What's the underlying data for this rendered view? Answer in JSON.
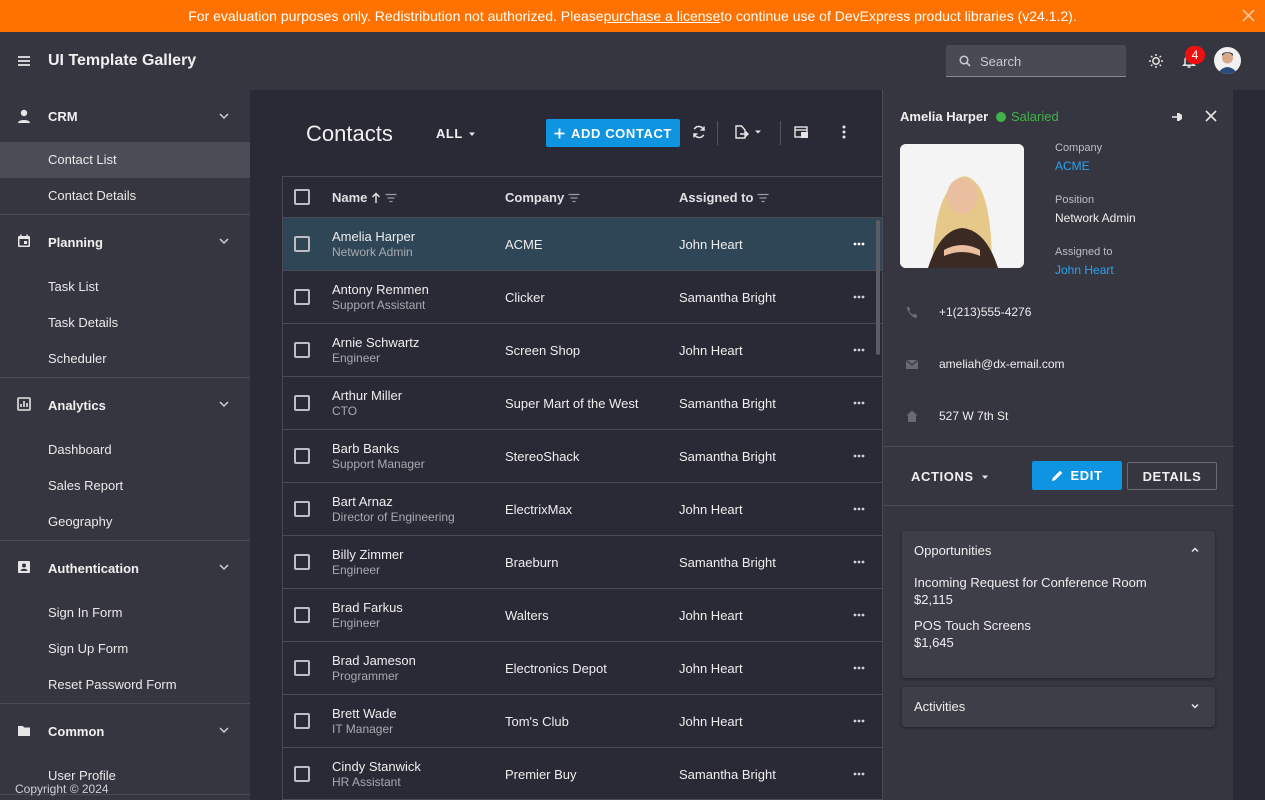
{
  "banner": {
    "text_before": "For evaluation purposes only. Redistribution not authorized. Please ",
    "link": "purchase a license",
    "text_after": " to continue use of DevExpress product libraries (v24.1.2)."
  },
  "header": {
    "title": "UI Template Gallery",
    "search_placeholder": "Search",
    "notification_count": "4"
  },
  "sidebar": {
    "groups": [
      {
        "label": "CRM",
        "icon": "person-icon",
        "items": [
          "Contact List",
          "Contact Details"
        ]
      },
      {
        "label": "Planning",
        "icon": "calendar-icon",
        "items": [
          "Task List",
          "Task Details",
          "Scheduler"
        ]
      },
      {
        "label": "Analytics",
        "icon": "chart-icon",
        "items": [
          "Dashboard",
          "Sales Report",
          "Geography"
        ]
      },
      {
        "label": "Authentication",
        "icon": "id-card-icon",
        "items": [
          "Sign In Form",
          "Sign Up Form",
          "Reset Password Form"
        ]
      },
      {
        "label": "Common",
        "icon": "folder-icon",
        "items": [
          "User Profile"
        ]
      }
    ],
    "active_item": "Contact List",
    "copyright": "Copyright © 2024"
  },
  "main": {
    "title": "Contacts",
    "filter": "ALL",
    "add_button": "ADD CONTACT",
    "columns": {
      "name": "Name",
      "company": "Company",
      "assigned": "Assigned to"
    },
    "rows": [
      {
        "name": "Amelia Harper",
        "position": "Network Admin",
        "company": "ACME",
        "assigned": "John Heart"
      },
      {
        "name": "Antony Remmen",
        "position": "Support Assistant",
        "company": "Clicker",
        "assigned": "Samantha Bright"
      },
      {
        "name": "Arnie Schwartz",
        "position": "Engineer",
        "company": "Screen Shop",
        "assigned": "John Heart"
      },
      {
        "name": "Arthur Miller",
        "position": "CTO",
        "company": "Super Mart of the West",
        "assigned": "Samantha Bright"
      },
      {
        "name": "Barb Banks",
        "position": "Support Manager",
        "company": "StereoShack",
        "assigned": "Samantha Bright"
      },
      {
        "name": "Bart Arnaz",
        "position": "Director of Engineering",
        "company": "ElectrixMax",
        "assigned": "John Heart"
      },
      {
        "name": "Billy Zimmer",
        "position": "Engineer",
        "company": "Braeburn",
        "assigned": "Samantha Bright"
      },
      {
        "name": "Brad Farkus",
        "position": "Engineer",
        "company": "Walters",
        "assigned": "John Heart"
      },
      {
        "name": "Brad Jameson",
        "position": "Programmer",
        "company": "Electronics Depot",
        "assigned": "John Heart"
      },
      {
        "name": "Brett Wade",
        "position": "IT Manager",
        "company": "Tom's Club",
        "assigned": "John Heart"
      },
      {
        "name": "Cindy Stanwick",
        "position": "HR Assistant",
        "company": "Premier Buy",
        "assigned": "Samantha Bright"
      }
    ]
  },
  "panel": {
    "name": "Amelia Harper",
    "status": "Salaried",
    "company_label": "Company",
    "company": "ACME",
    "position_label": "Position",
    "position": "Network Admin",
    "assigned_label": "Assigned to",
    "assigned": "John Heart",
    "phone": "+1(213)555-4276",
    "email": "ameliah@dx-email.com",
    "address": "527 W 7th St",
    "actions_label": "ACTIONS",
    "edit_label": "EDIT",
    "details_label": "DETAILS",
    "opportunities_title": "Opportunities",
    "opportunities": [
      {
        "title": "Incoming Request for Conference Room",
        "amount": "$2,115"
      },
      {
        "title": "POS Touch Screens",
        "amount": "$1,645"
      }
    ],
    "activities_title": "Activities"
  },
  "colors": {
    "accent": "#0e94e0",
    "banner": "#ff7200",
    "status": "#3fb449",
    "link": "#2aa3ef"
  }
}
